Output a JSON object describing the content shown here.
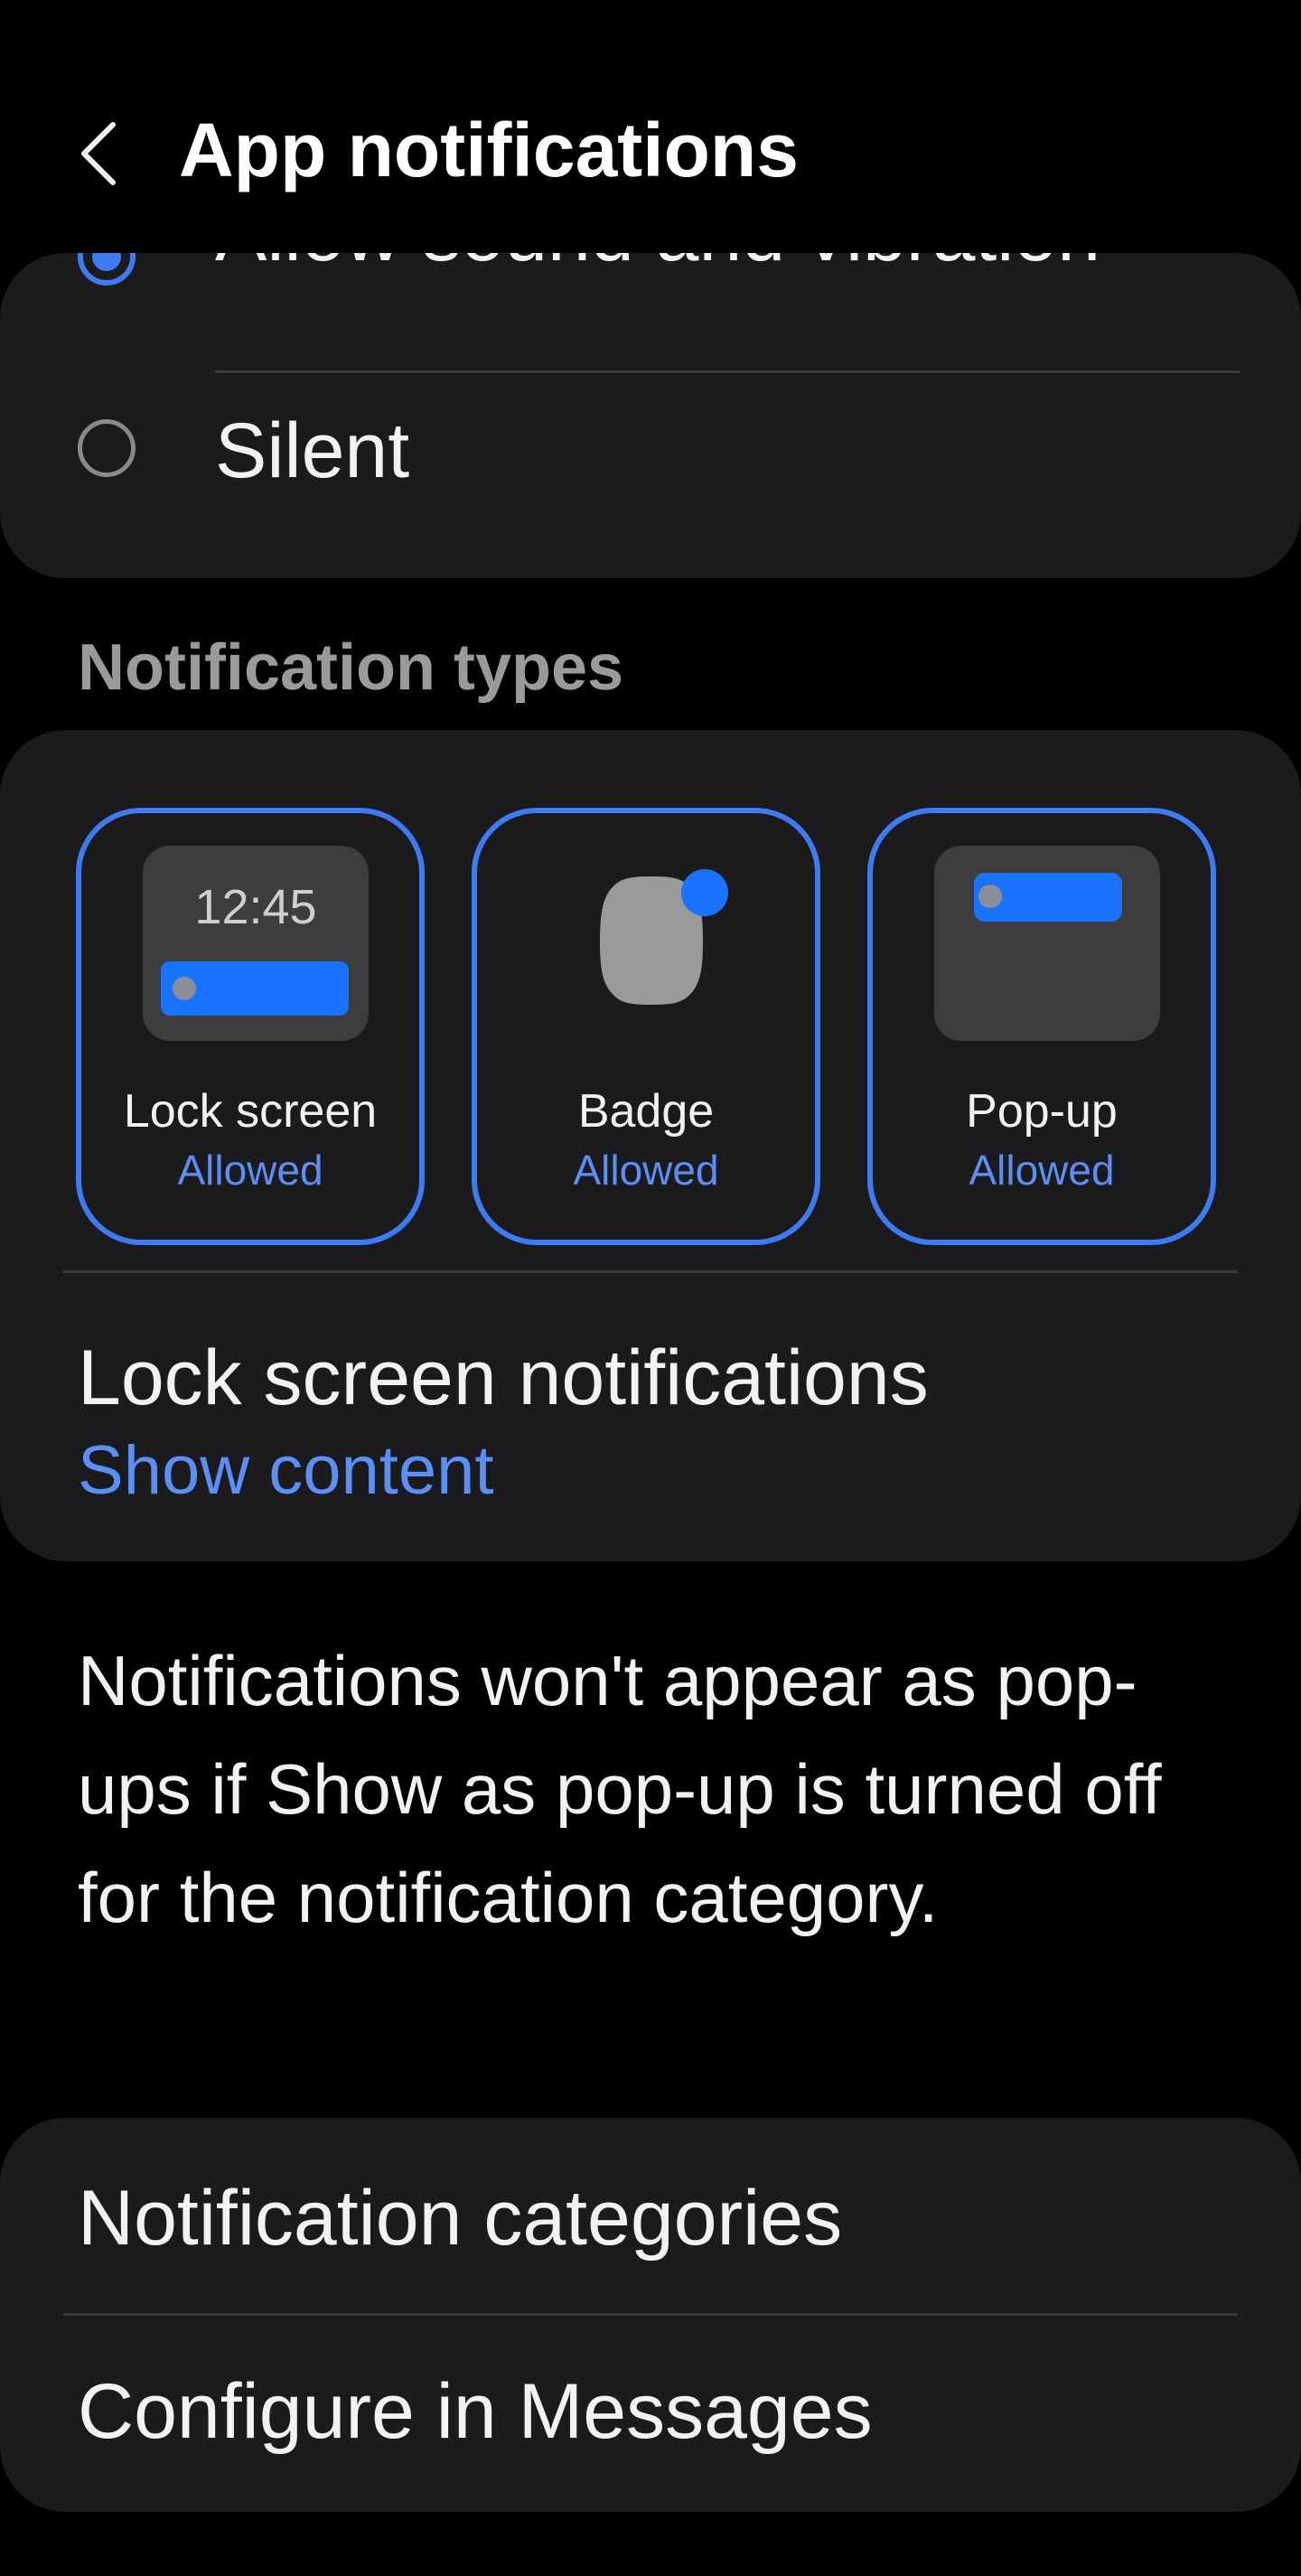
{
  "header": {
    "title": "App notifications",
    "back_icon": "chevron-left-icon"
  },
  "sound_options": {
    "items": [
      {
        "label": "Allow sound and vibration",
        "selected": true
      },
      {
        "label": "Silent",
        "selected": false
      }
    ]
  },
  "notification_types": {
    "section_title": "Notification types",
    "tiles": [
      {
        "title": "Lock screen",
        "status": "Allowed",
        "illustration_time": "12:45"
      },
      {
        "title": "Badge",
        "status": "Allowed"
      },
      {
        "title": "Pop-up",
        "status": "Allowed"
      }
    ],
    "lock_screen_notifications": {
      "title": "Lock screen notifications",
      "value": "Show content"
    }
  },
  "info_text": "Notifications won't appear as pop-ups if Show as pop-up is turned off for the notification category.",
  "bottom_list": {
    "items": [
      {
        "label": "Notification categories"
      },
      {
        "label": "Configure in Messages"
      }
    ]
  },
  "colors": {
    "background": "#000000",
    "card": "#1b1b1d",
    "accent": "#3e7bf2",
    "accent_text": "#5b8ff5",
    "section_header": "#9a9a9c"
  }
}
